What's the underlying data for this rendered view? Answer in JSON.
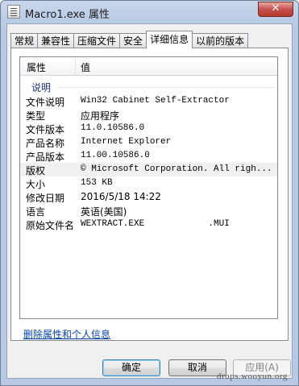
{
  "window": {
    "title": "Macro1.exe 属性",
    "close_label": "✕"
  },
  "tabs": [
    {
      "label": "常规",
      "active": false
    },
    {
      "label": "兼容性",
      "active": false
    },
    {
      "label": "压缩文件",
      "active": false
    },
    {
      "label": "安全",
      "active": false
    },
    {
      "label": "详细信息",
      "active": true
    },
    {
      "label": "以前的版本",
      "active": false
    }
  ],
  "list": {
    "headers": {
      "property": "属性",
      "value": "值"
    },
    "group_label": "说明",
    "rows": [
      {
        "key": "文件说明",
        "value": "Win32 Cabinet Self-Extractor"
      },
      {
        "key": "类型",
        "value": "应用程序"
      },
      {
        "key": "文件版本",
        "value": "11.0.10586.0"
      },
      {
        "key": "产品名称",
        "value": "Internet Explorer"
      },
      {
        "key": "产品版本",
        "value": "11.00.10586.0"
      },
      {
        "key": "版权",
        "value": "© Microsoft Corporation. All righ..."
      },
      {
        "key": "大小",
        "value": "153 KB"
      },
      {
        "key": "修改日期",
        "value": "2016/5/18 14:22"
      },
      {
        "key": "语言",
        "value": "英语(美国)"
      },
      {
        "key": "原始文件名",
        "value": "WEXTRACT.EXE            .MUI"
      }
    ]
  },
  "remove_link": "删除属性和个人信息",
  "buttons": {
    "ok": "确定",
    "cancel": "取消",
    "apply": "应用(A)"
  },
  "watermark": "drops.wooyun.org"
}
